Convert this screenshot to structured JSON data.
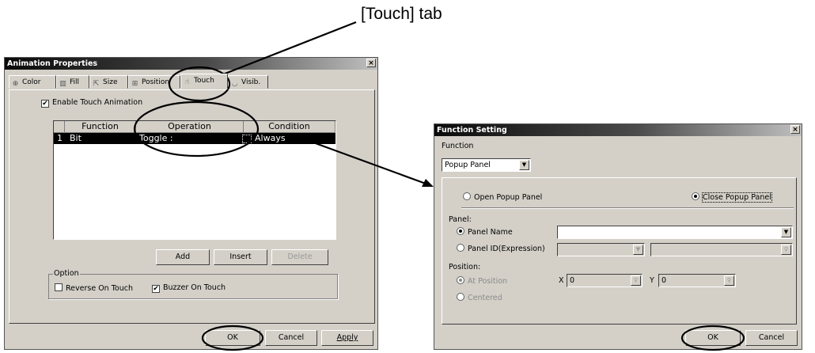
{
  "callout": {
    "label": "[Touch] tab"
  },
  "animation_dialog": {
    "title": "Animation Properties",
    "close_glyph": "×",
    "tabs": [
      {
        "label": "Color",
        "icon": "color-wheel-icon",
        "glyph": "⊕"
      },
      {
        "label": "Fill",
        "icon": "fill-icon",
        "glyph": "▥"
      },
      {
        "label": "Size",
        "icon": "size-icon",
        "glyph": "⇱"
      },
      {
        "label": "Position",
        "icon": "position-icon",
        "glyph": "⊞"
      },
      {
        "label": "Touch",
        "icon": "hand-pointer-icon",
        "glyph": "☝"
      },
      {
        "label": "Visib.",
        "icon": "visibility-icon",
        "glyph": "◡"
      }
    ],
    "enable_touch": {
      "label": "Enable Touch Animation",
      "checked": true
    },
    "grid": {
      "headers": [
        "Function",
        "Operation",
        "Condition"
      ],
      "rows": [
        {
          "num": "1",
          "function": "Bit",
          "operation": "Toggle :",
          "condition": "Always"
        }
      ]
    },
    "buttons": {
      "add": "Add",
      "insert": "Insert",
      "delete": "Delete"
    },
    "option": {
      "legend": "Option",
      "reverse_on_touch": {
        "label": "Reverse On Touch",
        "checked": false
      },
      "buzzer_on_touch": {
        "label": "Buzzer On Touch",
        "checked": true
      }
    },
    "footer": {
      "ok": "OK",
      "cancel": "Cancel",
      "apply": "Apply"
    }
  },
  "function_dialog": {
    "title": "Function Setting",
    "close_glyph": "×",
    "function_label": "Function",
    "function_value": "Popup Panel",
    "open_popup": {
      "label": "Open Popup Panel",
      "selected": false
    },
    "close_popup": {
      "label": "Close Popup Panel",
      "selected": true
    },
    "panel_label": "Panel:",
    "panel_name": {
      "label": "Panel Name",
      "selected": true,
      "value": ""
    },
    "panel_id": {
      "label": "Panel ID(Expression)",
      "selected": false
    },
    "position_label": "Position:",
    "at_position": {
      "label": "At Position",
      "selected": true
    },
    "x_label": "X",
    "x_value": "0",
    "y_label": "Y",
    "y_value": "0",
    "centered": {
      "label": "Centered",
      "selected": false
    },
    "footer": {
      "ok": "OK",
      "cancel": "Cancel"
    }
  }
}
